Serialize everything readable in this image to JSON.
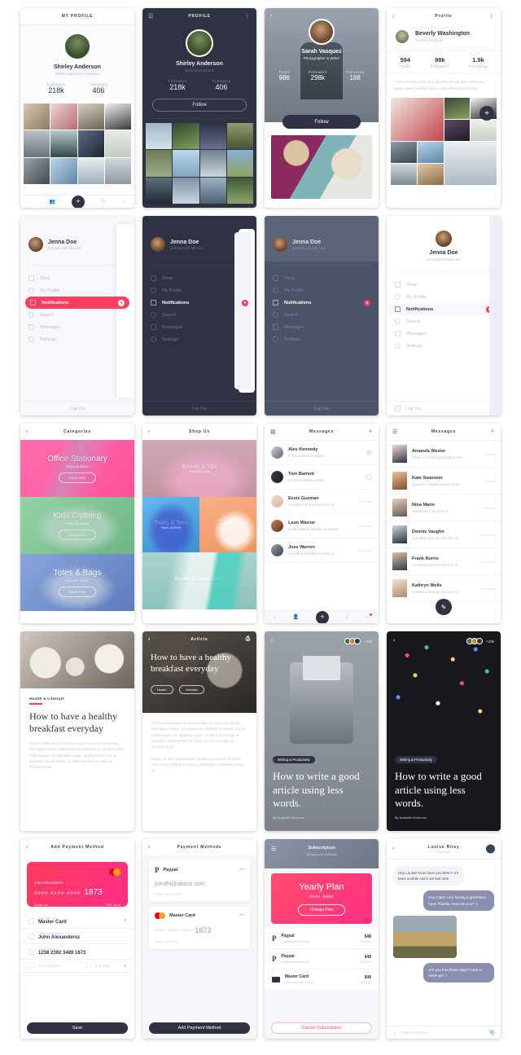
{
  "screens": {
    "profile_light": {
      "header": "MY PROFILE",
      "name": "Shirley Anderson",
      "role": "Mobile App UI/UX Designer",
      "stats": [
        {
          "label": "Followers",
          "value": "218k"
        },
        {
          "label": "Following",
          "value": "406"
        }
      ],
      "nav": [
        "heart-icon",
        "people-icon",
        "plus-icon",
        "refresh-icon",
        "message-icon"
      ]
    },
    "profile_dark": {
      "header": "PROFILE",
      "menu_icon": "hamburger-icon",
      "more_icon": "more-vertical-icon",
      "name": "Shirley Anderson",
      "handle": "@shirleyanderson",
      "stats": [
        {
          "label": "Followers",
          "value": "218k"
        },
        {
          "label": "Following",
          "value": "406"
        }
      ],
      "follow_label": "Follow"
    },
    "profile_hero": {
      "back_icon": "chevron-left-icon",
      "name": "Sarah Vasquez",
      "role": "Photographer & Writer",
      "stats": [
        {
          "label": "Posts",
          "value": "986"
        },
        {
          "label": "Followers",
          "value": "298k"
        },
        {
          "label": "Following",
          "value": "198"
        }
      ],
      "follow_label": "Follow"
    },
    "profile_feed": {
      "header": "Profile",
      "back_icon": "chevron-left-icon",
      "more_icon": "more-vertical-icon",
      "name": "Beverly Washington",
      "role": "Product Designer",
      "stats": [
        {
          "label": "Posts",
          "value": "594"
        },
        {
          "label": "Followers",
          "value": "98k"
        },
        {
          "label": "Following",
          "value": "1.9k"
        }
      ],
      "bio": "Fusce vehicula dolor arcu, sit amet blandit dolor mollis nec. Donec viverra eleifend lacus, vitae ullamcorper metus.",
      "fab_icon": "plus-icon"
    },
    "menu": {
      "user": "Jenna Doe",
      "email": "jennadoe@mail.com",
      "items": [
        {
          "label": "Shop",
          "icon": "bag-icon"
        },
        {
          "label": "My Profile",
          "icon": "user-icon"
        },
        {
          "label": "Notifications",
          "icon": "bell-icon",
          "badge": "5",
          "active": true
        },
        {
          "label": "Search",
          "icon": "search-icon"
        },
        {
          "label": "Messages",
          "icon": "chat-icon"
        },
        {
          "label": "Settings",
          "icon": "gear-icon"
        }
      ],
      "logout": "Log Out"
    },
    "categories": {
      "header": "Categories",
      "back_icon": "chevron-left-icon",
      "items": [
        {
          "title": "Office Stationary",
          "subtitle": "From US $8.00",
          "button": "Shop Now",
          "color": "#ff5fa2"
        },
        {
          "title": "Kids Clothing",
          "subtitle": "From US $16.00",
          "button": "Shop Now",
          "color": "#7dc28e"
        },
        {
          "title": "Totes & Bags",
          "subtitle": "From US $24.00",
          "button": "Shop Now",
          "color": "#6f8fd1"
        }
      ]
    },
    "shop": {
      "header": "Shop Us",
      "back_icon": "chevron-left-icon",
      "items": [
        {
          "title": "Beauty & Spa",
          "subtitle": "From US $12.00",
          "color": "#c9a2ab"
        },
        {
          "title": "Tanks & Tees",
          "subtitle": "From US $9.00",
          "color": "#5ab4e8"
        },
        {
          "title": "Coffee",
          "subtitle": "From US $18.00",
          "color": "#f2a477"
        },
        {
          "title": "Books & Magazines",
          "subtitle": "From US $6.00",
          "color": "#9fcfc9"
        }
      ]
    },
    "messages_a": {
      "header": "Messages",
      "left_icon": "archive-icon",
      "add_icon": "plus-icon",
      "rows": [
        {
          "name": "Alex Kennedy",
          "preview": "In har hofdimon plates",
          "unread": true
        },
        {
          "name": "Tom Barnett",
          "preview": "In har hofdimon plates",
          "unread": true
        },
        {
          "name": "Essie Guzman",
          "preview": "Curabitur lobortis id lorem id",
          "time": "Yesterday"
        },
        {
          "name": "Leon Warner",
          "preview": "Nulla porttitor blandit venenatis",
          "time": "Yesterday"
        },
        {
          "name": "Jose Warren",
          "preview": "Curabitur lobortis id lorem id",
          "time": "Yesterday"
        }
      ],
      "nav": [
        "home-icon",
        "people-icon",
        "plus-icon",
        "bag-icon",
        "chat-icon"
      ]
    },
    "messages_b": {
      "header": "Messages",
      "menu_icon": "hamburger-icon",
      "search_icon": "search-icon",
      "rows": [
        {
          "name": "Amanda Wexler",
          "preview": "There is a very good place nea...",
          "time": "A while"
        },
        {
          "name": "Kate Swanson",
          "preview": "Quisque volutpat augue enim.",
          "time": "A while"
        },
        {
          "name": "Nina Mann",
          "preview": "Vestibulum nec erat ut.",
          "time": "Yesterday"
        },
        {
          "name": "Dennis Vaughn",
          "preview": "Curabitur lobortis id lorem id",
          "time": "Yesterday"
        },
        {
          "name": "Frank Norris",
          "preview": "Curabitur lobortis id lorem id",
          "time": "Yesterday"
        },
        {
          "name": "Kathryn Wells",
          "preview": "Curabitur lobortis id lorem id",
          "time": "Yesterday"
        }
      ],
      "fab_icon": "compose-icon"
    },
    "article_light": {
      "back_icon": "chevron-left-icon",
      "tag": "Health & Lifestyle",
      "title": "How to have a healthy breakfast everyday",
      "body": "Donec facilisis tortor ut augue lacinia, at viverra est semper. Sed sapien metus, scelerisque nec pharetra id, tempor a tortor. Pellentesque non dignissim neque. Ut porta viverra est, ut dignissim elit elementum ut. Nunc sed rhoncus nibh, ut tincidunt turpis."
    },
    "article_hero": {
      "header": "Article",
      "back_icon": "chevron-left-icon",
      "bookmark_icon": "bookmark-icon",
      "title": "How to have a healthy breakfast everyday",
      "chips": [
        "Health",
        "Lifestyle"
      ],
      "body1": "Donec facilisis tortor ut augue lacinia, at viverra est semper. Sed sapien metus, scelerisque nec pharetra id, tempor a tortor. Pellentesque non dignissim neque. Ut porta viverra est, ut dignissim elit elementum at. Nunc sed rhoncus nibh, ut tincidunt turpis.",
      "body2": "Integer ac enim pellentesque, adipiscing metus id, pharetra odio. Donec bibendum nunc sit amet tortor scelerisque luctus ut."
    },
    "article_typewriter": {
      "back_icon": "chevron-left-icon",
      "readers_count": "+23k",
      "tag": "Writing & Productivity",
      "title": "How to write a good article using less words.",
      "author": "By Anabelle Dinsmore"
    },
    "article_confetti": {
      "back_icon": "chevron-left-icon",
      "readers_count": "+23k",
      "tag": "Writing & Productivity",
      "title": "How to write a good article using less words.",
      "author": "By Anabelle Dinsmore"
    },
    "add_payment": {
      "header": "Add Payment Method",
      "back_icon": "chevron-left-icon",
      "card": {
        "holder": "John Alexandersz",
        "masked": "#### #### ####",
        "last4": "1873",
        "expire_label": "Expire on",
        "cvc_label": "CVC Num",
        "brand_icon": "mastercard-icon"
      },
      "fields": [
        {
          "label": "Payment Type",
          "value": "Master Card",
          "icon": "card-icon",
          "dropdown": true
        },
        {
          "label": "Card Holder Name",
          "value": "John Alexandersz",
          "icon": "lock-icon"
        },
        {
          "label": "Card Number",
          "value": "1238 2392 3489 1873",
          "icon": "card-icon"
        }
      ],
      "cvc_placeholder": "CVC number",
      "exp_placeholder": "Exp date",
      "save_label": "Save"
    },
    "payment_methods": {
      "header": "Payment Methods",
      "back_icon": "chevron-left-icon",
      "cards": [
        {
          "brand": "Paypal",
          "icon": "paypal-icon",
          "value": "johnlht@abcco.com",
          "meta": "Added on 05/10/19",
          "more_icon": "more-horizontal-icon"
        },
        {
          "brand": "Master Card",
          "icon": "mastercard-icon",
          "masked": "**** **** ****",
          "last4": "1873",
          "meta": "Expire on 10/20",
          "more_icon": "more-horizontal-icon"
        }
      ],
      "add_label": "Add Payment Method"
    },
    "subscription": {
      "header": "Subscription",
      "subheader": "All payment methods",
      "menu_icon": "hamburger-icon",
      "plan_title": "Yearly Plan",
      "plan_price": "$4/mo - $48/yr",
      "change_label": "Change Plan",
      "rows": [
        {
          "brand": "Paypal",
          "icon": "paypal-icon",
          "detail": "johnlht@abcco.com",
          "amount": "$48",
          "date": "10/04/19"
        },
        {
          "brand": "Paypal",
          "icon": "paypal-icon",
          "detail": "johnlht@abcco.com",
          "amount": "$48",
          "date": "10/04/19"
        },
        {
          "brand": "Master Card",
          "icon": "card-icon",
          "detail": "Card ending ***1873",
          "amount": "$48",
          "date": "10/04/19"
        }
      ],
      "cancel_label": "Cancel Subscription"
    },
    "chat": {
      "header": "Louise Riley",
      "status": "Online",
      "back_icon": "chevron-left-icon",
      "avatar_icon": "avatar",
      "bubbles": [
        {
          "dir": "in",
          "text": "Hey Louise! How have you been? It's been a while since we last met!"
        },
        {
          "dir": "out",
          "text": "Hey Clark! I am having a great time here! Thanks. How are you? :)"
        },
        {
          "dir": "image"
        },
        {
          "dir": "out",
          "text": "Are you free these days? Care to meet up? :)"
        }
      ],
      "input_placeholder": "Type something...",
      "attach_icon": "paperclip-icon",
      "smiley_icon": "smiley-icon"
    }
  },
  "colors": {
    "accent_red": "#ff3d5e",
    "dark": "#2f3243",
    "text": "#2f3449",
    "muted": "#b9bdca"
  }
}
